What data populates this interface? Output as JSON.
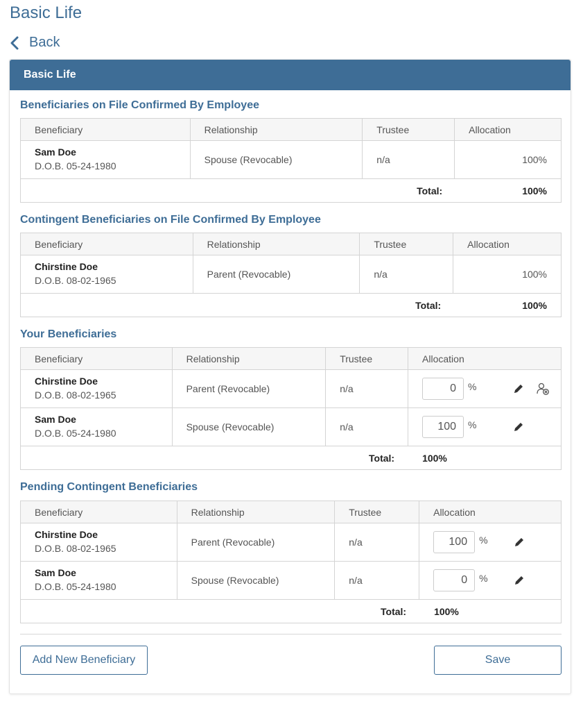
{
  "page": {
    "title": "Basic Life",
    "back_label": "Back"
  },
  "card": {
    "header": "Basic Life"
  },
  "columns": {
    "beneficiary": "Beneficiary",
    "relationship": "Relationship",
    "trustee": "Trustee",
    "allocation": "Allocation"
  },
  "total_label": "Total:",
  "confirmed_primary": {
    "title": "Beneficiaries on File Confirmed By Employee",
    "rows": [
      {
        "name": "Sam Doe",
        "dob": "D.O.B. 05-24-1980",
        "relationship": "Spouse (Revocable)",
        "trustee": "n/a",
        "allocation": "100%"
      }
    ],
    "total": "100%"
  },
  "confirmed_contingent": {
    "title": "Contingent Beneficiaries on File Confirmed By Employee",
    "rows": [
      {
        "name": "Chirstine Doe",
        "dob": "D.O.B. 08-02-1965",
        "relationship": "Parent (Revocable)",
        "trustee": "n/a",
        "allocation": "100%"
      }
    ],
    "total": "100%"
  },
  "your_beneficiaries": {
    "title": "Your Beneficiaries",
    "rows": [
      {
        "name": "Chirstine Doe",
        "dob": "D.O.B. 08-02-1965",
        "relationship": "Parent (Revocable)",
        "trustee": "n/a",
        "allocation": "0",
        "pct": "%"
      },
      {
        "name": "Sam Doe",
        "dob": "D.O.B. 05-24-1980",
        "relationship": "Spouse (Revocable)",
        "trustee": "n/a",
        "allocation": "100",
        "pct": "%"
      }
    ],
    "total": "100%"
  },
  "pending_contingent": {
    "title": "Pending Contingent Beneficiaries",
    "rows": [
      {
        "name": "Chirstine Doe",
        "dob": "D.O.B. 08-02-1965",
        "relationship": "Parent (Revocable)",
        "trustee": "n/a",
        "allocation": "100",
        "pct": "%"
      },
      {
        "name": "Sam Doe",
        "dob": "D.O.B. 05-24-1980",
        "relationship": "Spouse (Revocable)",
        "trustee": "n/a",
        "allocation": "0",
        "pct": "%"
      }
    ],
    "total": "100%"
  },
  "buttons": {
    "add_label": "Add New Beneficiary",
    "save_label": "Save"
  },
  "colors": {
    "accent": "#3e6d96",
    "border": "#d4d4d4",
    "header_bg": "#f6f6f6"
  },
  "icons": {
    "back": "chevron-left-icon",
    "edit": "pencil-icon",
    "remove": "remove-user-icon"
  }
}
